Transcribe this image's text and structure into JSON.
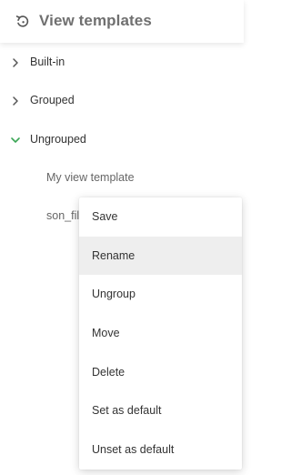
{
  "header": {
    "title": "View templates",
    "back_icon": "history-back-icon"
  },
  "tree": {
    "groups": [
      {
        "label": "Built-in",
        "expanded": false
      },
      {
        "label": "Grouped",
        "expanded": false
      },
      {
        "label": "Ungrouped",
        "expanded": true
      }
    ],
    "leaves": [
      {
        "label": "My view template"
      },
      {
        "label": "son_filt"
      }
    ]
  },
  "context_menu": {
    "items": [
      {
        "label": "Save"
      },
      {
        "label": "Rename"
      },
      {
        "label": "Ungroup"
      },
      {
        "label": "Move"
      },
      {
        "label": "Delete"
      },
      {
        "label": "Set as default"
      },
      {
        "label": "Unset as default"
      }
    ],
    "highlighted": "Rename"
  },
  "colors": {
    "accent": "#3aa655",
    "chevron": "#555555",
    "highlight": "#eeeeee"
  }
}
